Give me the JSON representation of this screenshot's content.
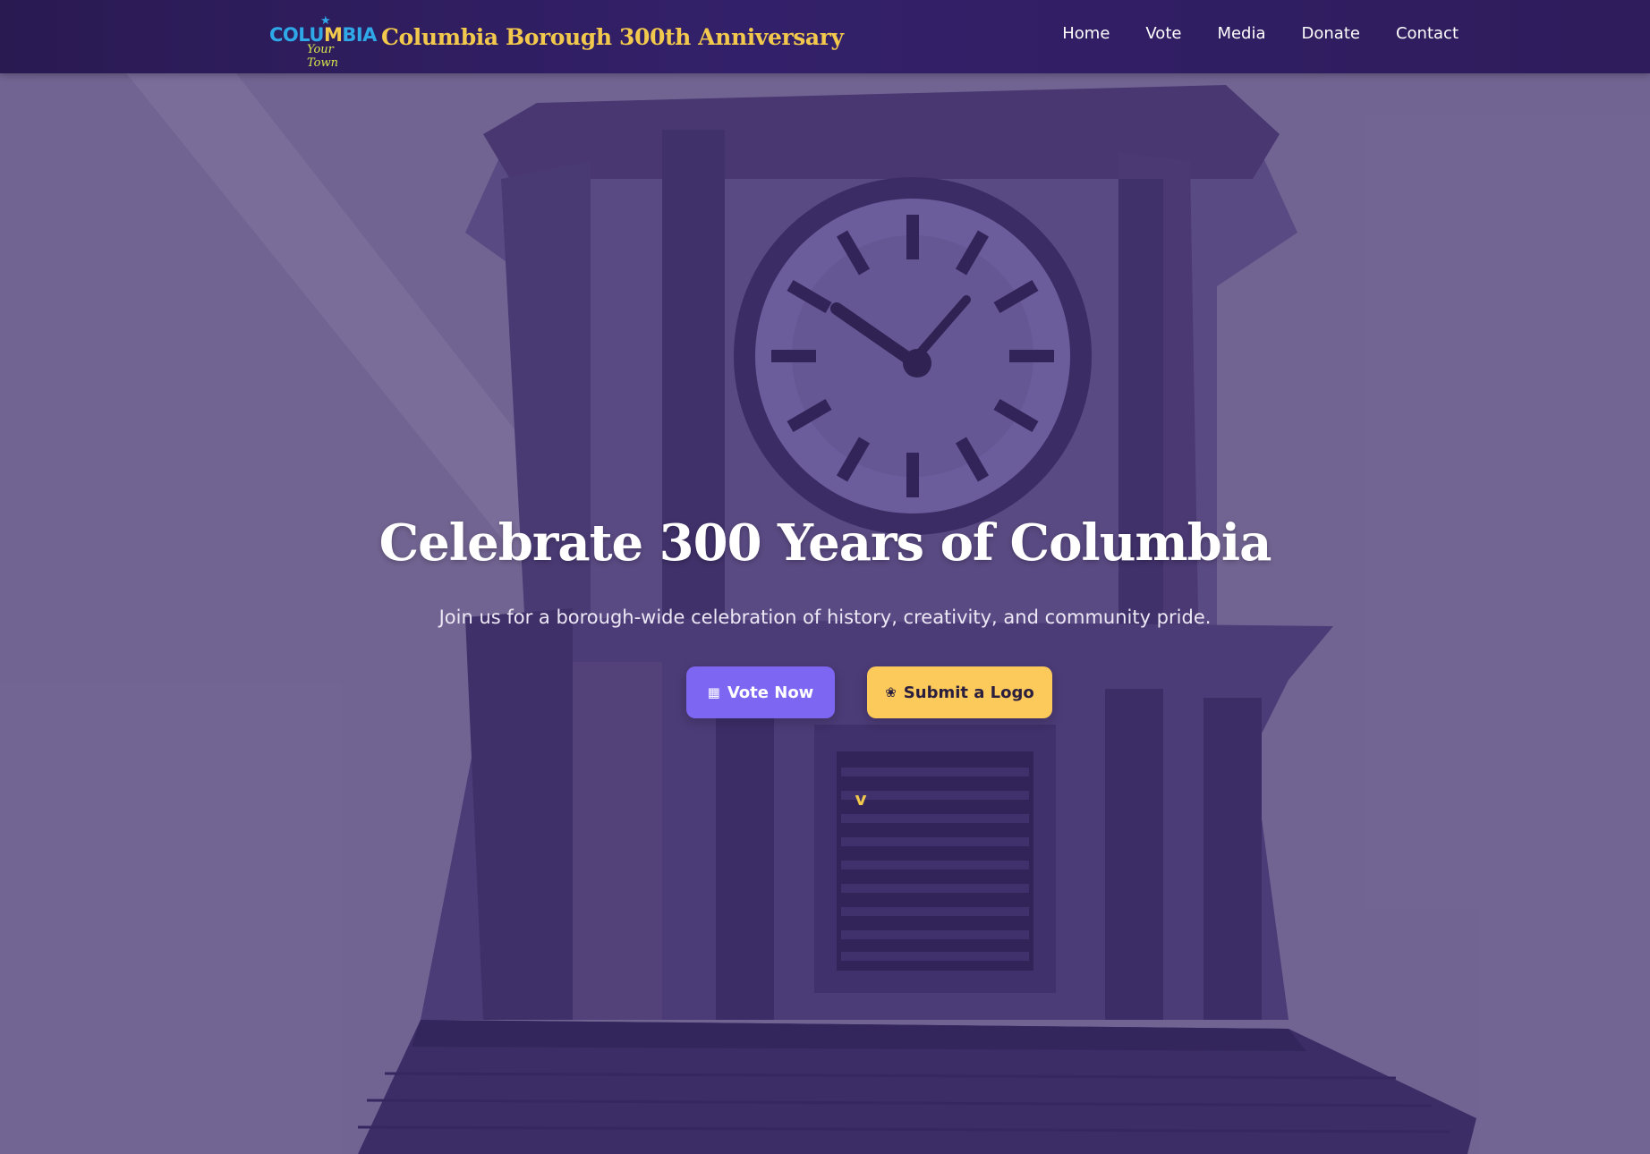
{
  "header": {
    "logo": {
      "word_left": "COLU",
      "word_mid": "M",
      "word_right": "BIA",
      "tagline": "Your Town"
    },
    "site_title": "Columbia Borough 300th Anniversary",
    "nav": [
      {
        "label": "Home"
      },
      {
        "label": "Vote"
      },
      {
        "label": "Media"
      },
      {
        "label": "Donate"
      },
      {
        "label": "Contact"
      }
    ]
  },
  "hero": {
    "title": "Celebrate 300 Years of Columbia",
    "subtitle": "Join us for a borough-wide celebration of history, creativity, and community pride.",
    "buttons": {
      "vote": {
        "label": "Vote Now",
        "icon": "ballot-box-icon"
      },
      "submit": {
        "label": "Submit a Logo",
        "icon": "palette-icon"
      }
    },
    "scroll_hint": "v"
  },
  "colors": {
    "header_bg": "#2e1c5c",
    "title_gold": "#f2c94c",
    "vote_button": "#7d66f2",
    "submit_button": "#fcc95b",
    "overlay": "#7a6e96"
  }
}
